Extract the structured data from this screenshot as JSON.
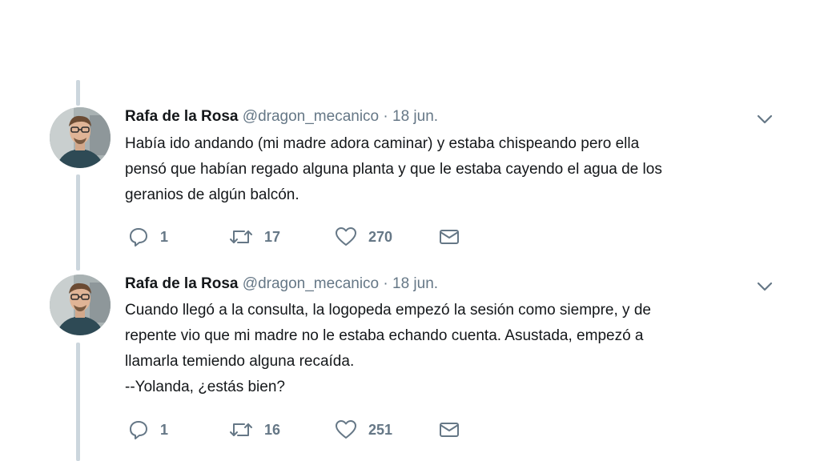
{
  "tweets": [
    {
      "name": "Rafa de la Rosa",
      "handle": "@dragon_mecanico",
      "separator": "·",
      "date": "18 jun.",
      "lines": [
        "Había ido andando (mi madre adora caminar) y estaba chispeando pero ella",
        "pensó que habían regado alguna planta y que le estaba cayendo el agua de los",
        "geranios de algún balcón."
      ],
      "replies": "1",
      "retweets": "17",
      "likes": "270"
    },
    {
      "name": "Rafa de la Rosa",
      "handle": "@dragon_mecanico",
      "separator": "·",
      "date": "18 jun.",
      "lines": [
        "Cuando llegó a la consulta, la logopeda empezó la sesión como siempre, y de",
        "repente vio que mi madre no le estaba echando cuenta. Asustada, empezó a",
        "llamarla temiendo alguna recaída.",
        "--Yolanda, ¿estás bien?"
      ],
      "replies": "1",
      "retweets": "16",
      "likes": "251"
    }
  ],
  "icons": {
    "reply": "reply-icon",
    "retweet": "retweet-icon",
    "like": "heart-icon",
    "dm": "envelope-icon",
    "caret": "chevron-down-icon"
  },
  "colors": {
    "text": "#14171a",
    "secondary": "#657786",
    "thread_line": "#ccd6dd"
  }
}
